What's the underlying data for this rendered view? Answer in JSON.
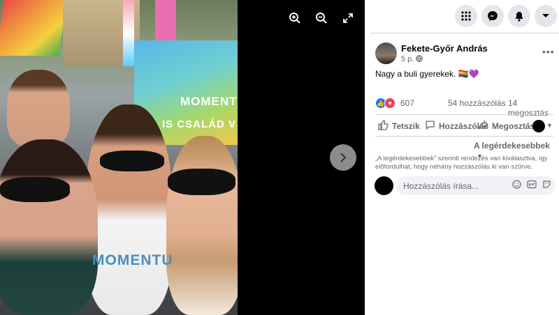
{
  "viewer": {
    "zoom_in_icon": "zoom-in-icon",
    "zoom_out_icon": "zoom-out-icon",
    "fullscreen_icon": "fullscreen-icon",
    "next_icon": "chevron-right-icon",
    "photo": {
      "banner_line1": "MOMENT",
      "banner_line2": "IS CSALÁD V",
      "shirt_text": "MOMENTU"
    }
  },
  "topbar": {
    "icons": [
      "menu-grid-icon",
      "messenger-icon",
      "notifications-icon",
      "account-dropdown-icon"
    ]
  },
  "post": {
    "author": "Fekete-Győr András",
    "time": "5 p.",
    "privacy_icon": "globe-icon",
    "text": "Nagy a buli gyerekek. 🏳️‍🌈💜",
    "reactions_count": "607",
    "comments_count": "54 hozzászólás",
    "shares_count": "14 megosztás"
  },
  "actions": {
    "like": "Tetszik",
    "comment": "Hozzászólás",
    "share": "Megosztás"
  },
  "comments": {
    "sort_label": "A legérdekesebbek",
    "note": "„A legérdekesebbek” szerinti rendezés van kiválasztva, így előfordulhat, hogy néhány hozzászólás ki van szűrve.",
    "input_placeholder": "Hozzászólás írása..."
  }
}
